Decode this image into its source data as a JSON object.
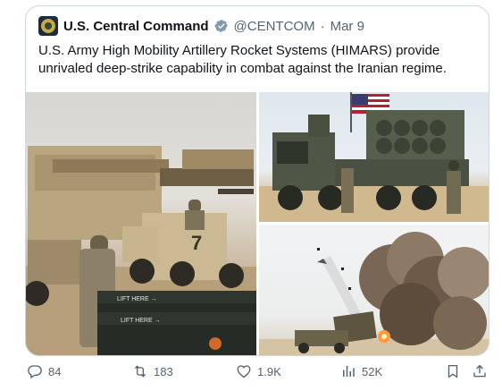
{
  "tweet": {
    "author_name": "U.S. Central Command",
    "handle": "@CENTCOM",
    "separator": "·",
    "date": "Mar 9",
    "text": "U.S. Army High Mobility Artillery Rocket Systems (HIMARS) provide unrivaled deep-strike capability in combat against the Iranian regime."
  },
  "photos": {
    "photo1": {
      "signs": [
        "LIFT HERE →",
        "LIFT HERE →"
      ]
    }
  },
  "actions": {
    "replies": "84",
    "reposts": "183",
    "likes": "1.9K",
    "views": "52K"
  },
  "colors": {
    "verified": "#829aab",
    "muted": "#536471",
    "border": "#cfd9de"
  },
  "icons": [
    "reply-icon",
    "repost-icon",
    "like-icon",
    "views-icon",
    "bookmark-icon",
    "share-icon",
    "verified-badge-icon"
  ]
}
